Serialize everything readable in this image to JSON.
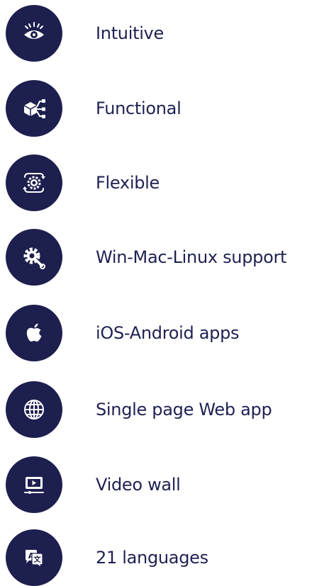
{
  "features": [
    {
      "label": "Intuitive",
      "icon": "eye-icon"
    },
    {
      "label": "Functional",
      "icon": "cube-network-icon"
    },
    {
      "label": "Flexible",
      "icon": "gear-arrows-icon"
    },
    {
      "label": "Win-Mac-Linux support",
      "icon": "gear-wrench-icon"
    },
    {
      "label": "iOS-Android apps",
      "icon": "apple-icon"
    },
    {
      "label": "Single page Web app",
      "icon": "globe-icon"
    },
    {
      "label": "Video wall",
      "icon": "play-screen-icon"
    },
    {
      "label": "21 languages",
      "icon": "translate-icon"
    }
  ],
  "colors": {
    "icon_background": "#1d1f4e",
    "text": "#1e2152",
    "icon_foreground": "#ffffff"
  }
}
